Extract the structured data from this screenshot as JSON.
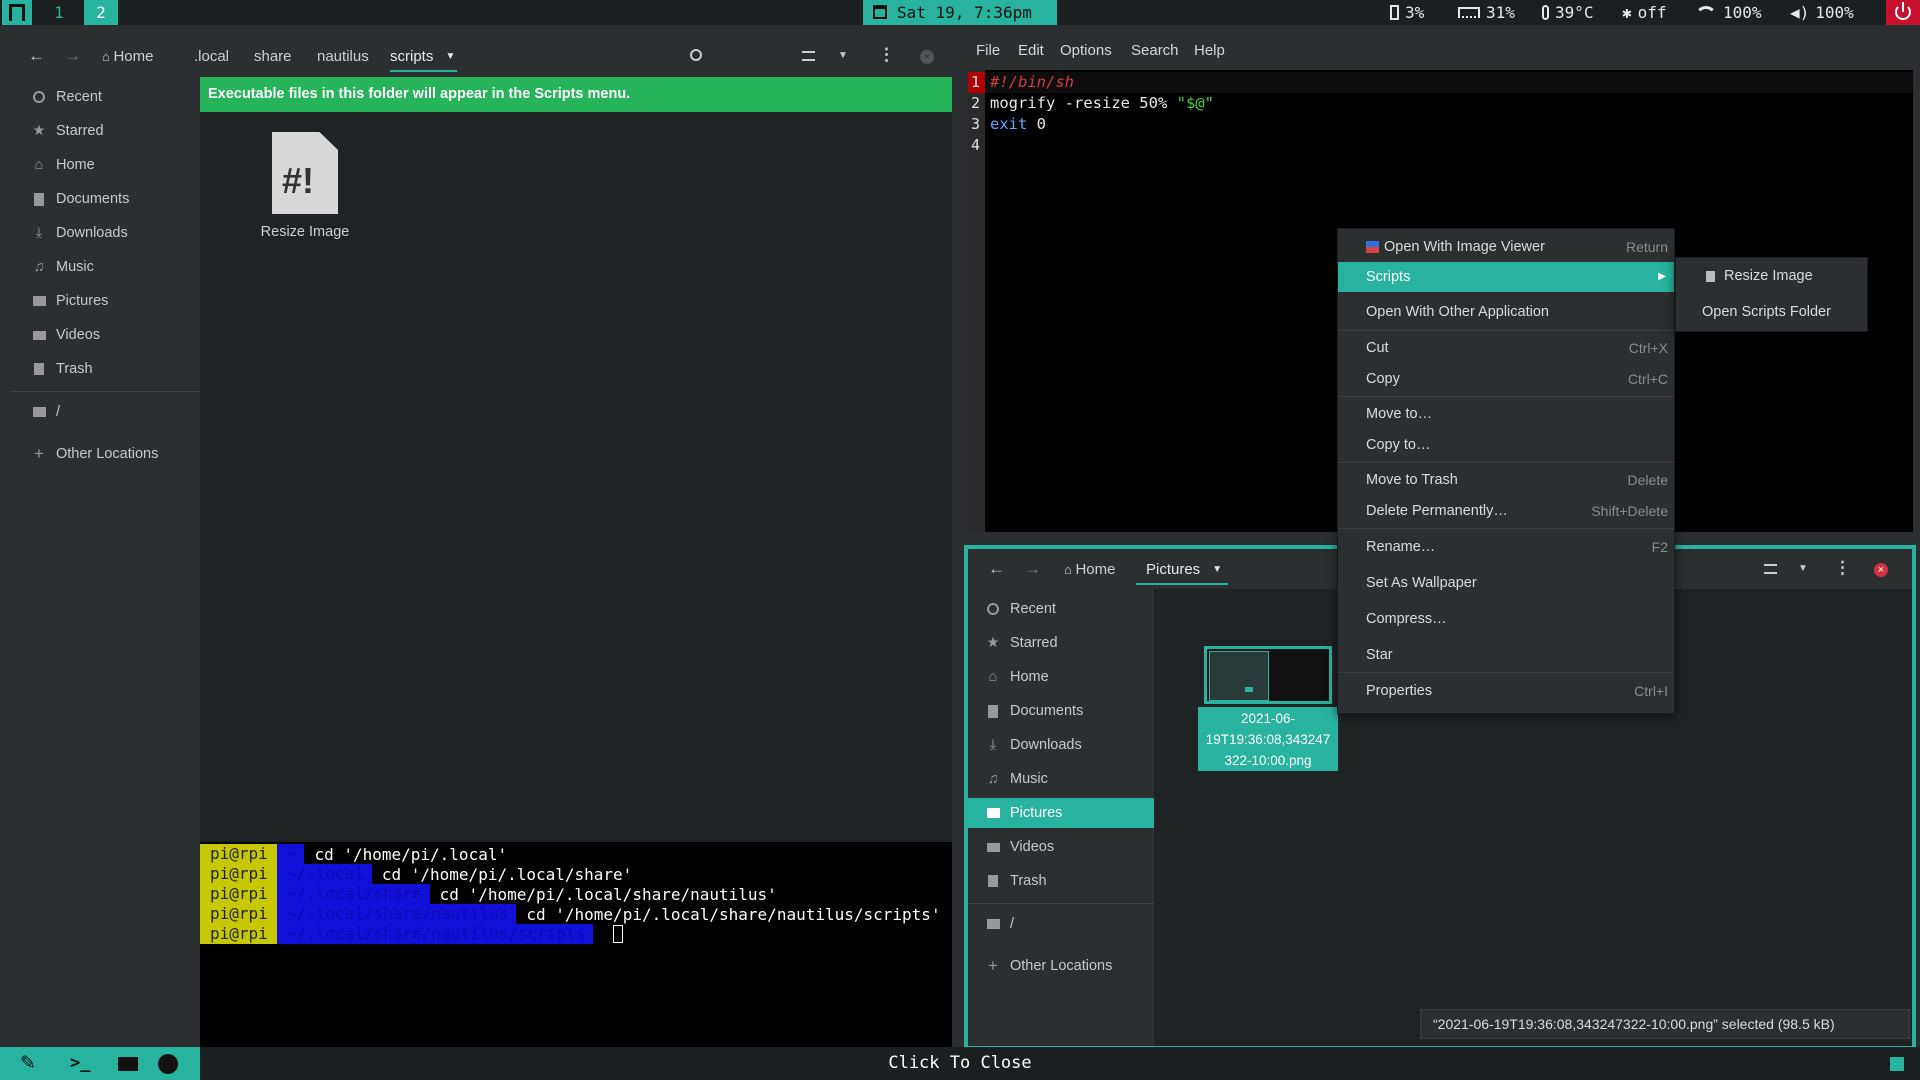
{
  "topbar": {
    "workspaces": [
      "1",
      "2"
    ],
    "clock": "Sat 19,  7:36pm",
    "battery": "3%",
    "memory": "31%",
    "temp": "39°C",
    "bluetooth": "off",
    "wifi": "100%",
    "volume": "100%"
  },
  "left_window": {
    "breadcrumbs": [
      "Home",
      ".local",
      "share",
      "nautilus",
      "scripts"
    ],
    "sidebar": [
      "Recent",
      "Starred",
      "Home",
      "Documents",
      "Downloads",
      "Music",
      "Pictures",
      "Videos",
      "Trash",
      "/",
      "Other Locations"
    ],
    "banner": "Executable files in this folder will appear in the Scripts menu.",
    "file": {
      "name": "Resize Image",
      "glyph": "#!"
    }
  },
  "terminal": {
    "lines": [
      {
        "user": "pi@rpi",
        "path": "~",
        "cmd": "cd '/home/pi/.local'"
      },
      {
        "user": "pi@rpi",
        "path": "~/.local",
        "cmd": "cd '/home/pi/.local/share'"
      },
      {
        "user": "pi@rpi",
        "path": "~/.local/share",
        "cmd": "cd '/home/pi/.local/share/nautilus'"
      },
      {
        "user": "pi@rpi",
        "path": "~/.local/share/nautilus",
        "cmd": "cd '/home/pi/.local/share/nautilus/scripts'"
      },
      {
        "user": "pi@rpi",
        "path": "~/.local/share/nautilus/scripts",
        "cmd": ""
      }
    ]
  },
  "editor": {
    "menu": [
      "File",
      "Edit",
      "Options",
      "Search",
      "Help"
    ],
    "line_numbers": [
      "1",
      "2",
      "3",
      "4"
    ],
    "lines": [
      {
        "a": "#!/bin/sh"
      },
      {
        "a": "mogrify -resize 50% ",
        "b": "\"$@\""
      },
      {
        "a": "exit ",
        "b": "0"
      },
      {
        "a": ""
      }
    ]
  },
  "right_window": {
    "breadcrumbs": [
      "Home",
      "Pictures"
    ],
    "sidebar": [
      "Recent",
      "Starred",
      "Home",
      "Documents",
      "Downloads",
      "Music",
      "Pictures",
      "Videos",
      "Trash",
      "/",
      "Other Locations"
    ],
    "selected_sidebar": "Pictures",
    "file": {
      "name_lines": [
        "2021-06-",
        "19T19:36:08,343247",
        "322-10:00.png"
      ]
    },
    "status": "“2021-06-19T19:36:08,343247322-10:00.png” selected  (98.5 kB)"
  },
  "context_menu": {
    "items": [
      {
        "label": "Open With Image Viewer",
        "shortcut": "Return"
      },
      {
        "label": "Scripts",
        "shortcut": ""
      },
      {
        "label": "Open With Other Application",
        "shortcut": ""
      },
      {
        "label": "Cut",
        "shortcut": "Ctrl+X"
      },
      {
        "label": "Copy",
        "shortcut": "Ctrl+C"
      },
      {
        "label": "Move to…",
        "shortcut": ""
      },
      {
        "label": "Copy to…",
        "shortcut": ""
      },
      {
        "label": "Move to Trash",
        "shortcut": "Delete"
      },
      {
        "label": "Delete Permanently…",
        "shortcut": "Shift+Delete"
      },
      {
        "label": "Rename…",
        "shortcut": "F2"
      },
      {
        "label": "Set As Wallpaper",
        "shortcut": ""
      },
      {
        "label": "Compress…",
        "shortcut": ""
      },
      {
        "label": "Star",
        "shortcut": ""
      },
      {
        "label": "Properties",
        "shortcut": "Ctrl+I"
      }
    ]
  },
  "scripts_submenu": [
    "Resize Image",
    "Open Scripts Folder"
  ],
  "bottombar": {
    "center": "Click To Close"
  },
  "colors": {
    "accent": "#27b3a0",
    "banner": "#26b35a",
    "close": "#d03040"
  }
}
